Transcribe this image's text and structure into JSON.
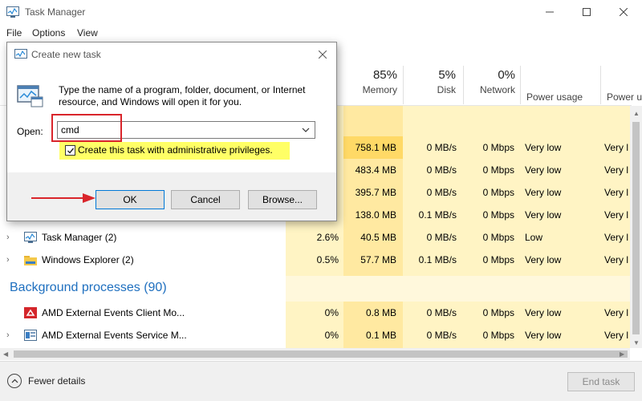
{
  "window": {
    "title": "Task Manager",
    "menu": [
      "File",
      "Options",
      "View"
    ]
  },
  "columns": [
    {
      "pct": "85%",
      "label": "Memory"
    },
    {
      "pct": "5%",
      "label": "Disk"
    },
    {
      "pct": "0%",
      "label": "Network"
    },
    {
      "pct": "",
      "label": "Power usage"
    },
    {
      "pct": "",
      "label": "Power u"
    }
  ],
  "hidden_rows": [
    {
      "memory": "758.1 MB",
      "disk": "0 MB/s",
      "network": "0 Mbps",
      "power": "Very low",
      "power_trend": "Very l"
    },
    {
      "memory": "483.4 MB",
      "disk": "0 MB/s",
      "network": "0 Mbps",
      "power": "Very low",
      "power_trend": "Very l"
    },
    {
      "memory": "395.7 MB",
      "disk": "0 MB/s",
      "network": "0 Mbps",
      "power": "Very low",
      "power_trend": "Very l"
    },
    {
      "memory": "138.0 MB",
      "disk": "0.1 MB/s",
      "network": "0 Mbps",
      "power": "Very low",
      "power_trend": "Very l"
    }
  ],
  "apps": [
    {
      "name": "Task Manager (2)",
      "cpu": "2.6%",
      "memory": "40.5 MB",
      "disk": "0 MB/s",
      "network": "0 Mbps",
      "power": "Low",
      "power_trend": "Very l"
    },
    {
      "name": "Windows Explorer (2)",
      "cpu": "0.5%",
      "memory": "57.7 MB",
      "disk": "0.1 MB/s",
      "network": "0 Mbps",
      "power": "Very low",
      "power_trend": "Very l"
    }
  ],
  "background_title": "Background processes (90)",
  "background": [
    {
      "name": "AMD External Events Client Mo...",
      "cpu": "0%",
      "memory": "0.8 MB",
      "disk": "0 MB/s",
      "network": "0 Mbps",
      "power": "Very low",
      "power_trend": "Very l"
    },
    {
      "name": "AMD External Events Service M...",
      "cpu": "0%",
      "memory": "0.1 MB",
      "disk": "0 MB/s",
      "network": "0 Mbps",
      "power": "Very low",
      "power_trend": "Very l"
    }
  ],
  "footer": {
    "fewer_details": "Fewer details",
    "end_task": "End task"
  },
  "dialog": {
    "title": "Create new task",
    "description": "Type the name of a program, folder, document, or Internet resource, and Windows will open it for you.",
    "open_label": "Open:",
    "open_value": "cmd",
    "admin_label": "Create this task with administrative privileges.",
    "admin_checked": true,
    "ok": "OK",
    "cancel": "Cancel",
    "browse": "Browse..."
  },
  "colors": {
    "heat_light": "#fff4c4",
    "heat_medium": "#ffe9a1",
    "heat_strong": "#ffd966",
    "highlight": "#ffff66",
    "annotation_red": "#d9252b",
    "section_blue": "#1e6fbf"
  }
}
